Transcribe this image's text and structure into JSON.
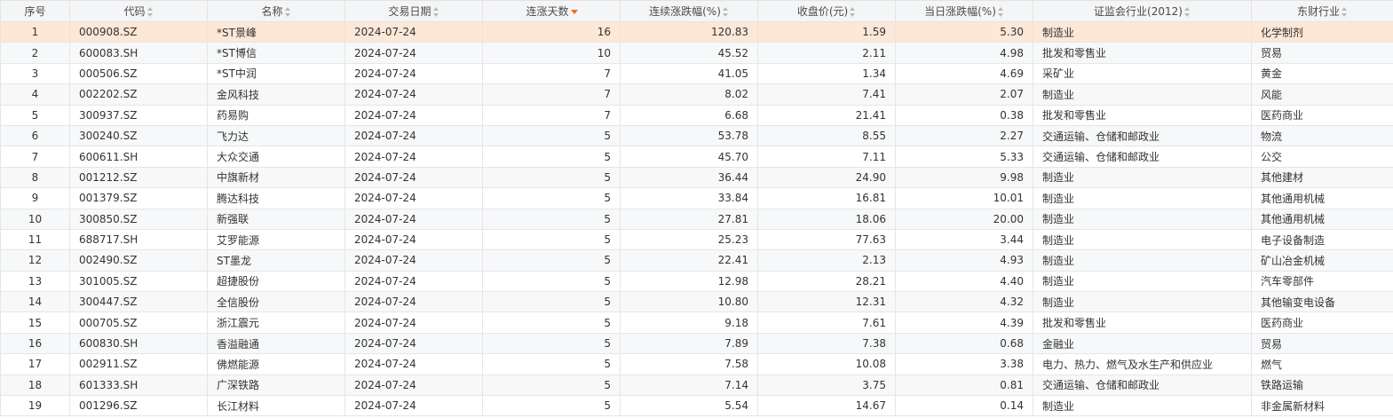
{
  "table": {
    "headers": [
      {
        "label": "序号",
        "sortable": false
      },
      {
        "label": "代码",
        "sortable": true
      },
      {
        "label": "名称",
        "sortable": true
      },
      {
        "label": "交易日期",
        "sortable": true
      },
      {
        "label": "连涨天数",
        "sortable": true,
        "active_sort": "desc"
      },
      {
        "label": "连续涨跌幅(%)",
        "sortable": true
      },
      {
        "label": "收盘价(元)",
        "sortable": true
      },
      {
        "label": "当日涨跌幅(%)",
        "sortable": true
      },
      {
        "label": "证监会行业(2012)",
        "sortable": true
      },
      {
        "label": "东财行业",
        "sortable": true
      }
    ],
    "highlight_row": 0,
    "highlight_color": "#fde7d7",
    "active_sort_color": "#f26b1d",
    "rows": [
      [
        "1",
        "000908.SZ",
        "*ST景峰",
        "2024-07-24",
        "16",
        "120.83",
        "1.59",
        "5.30",
        "制造业",
        "化学制剂"
      ],
      [
        "2",
        "600083.SH",
        "*ST博信",
        "2024-07-24",
        "10",
        "45.52",
        "2.11",
        "4.98",
        "批发和零售业",
        "贸易"
      ],
      [
        "3",
        "000506.SZ",
        "*ST中润",
        "2024-07-24",
        "7",
        "41.05",
        "1.34",
        "4.69",
        "采矿业",
        "黄金"
      ],
      [
        "4",
        "002202.SZ",
        "金风科技",
        "2024-07-24",
        "7",
        "8.02",
        "7.41",
        "2.07",
        "制造业",
        "风能"
      ],
      [
        "5",
        "300937.SZ",
        "药易购",
        "2024-07-24",
        "7",
        "6.68",
        "21.41",
        "0.38",
        "批发和零售业",
        "医药商业"
      ],
      [
        "6",
        "300240.SZ",
        "飞力达",
        "2024-07-24",
        "5",
        "53.78",
        "8.55",
        "2.27",
        "交通运输、仓储和邮政业",
        "物流"
      ],
      [
        "7",
        "600611.SH",
        "大众交通",
        "2024-07-24",
        "5",
        "45.70",
        "7.11",
        "5.33",
        "交通运输、仓储和邮政业",
        "公交"
      ],
      [
        "8",
        "001212.SZ",
        "中旗新材",
        "2024-07-24",
        "5",
        "36.44",
        "24.90",
        "9.98",
        "制造业",
        "其他建材"
      ],
      [
        "9",
        "001379.SZ",
        "腾达科技",
        "2024-07-24",
        "5",
        "33.84",
        "16.81",
        "10.01",
        "制造业",
        "其他通用机械"
      ],
      [
        "10",
        "300850.SZ",
        "新强联",
        "2024-07-24",
        "5",
        "27.81",
        "18.06",
        "20.00",
        "制造业",
        "其他通用机械"
      ],
      [
        "11",
        "688717.SH",
        "艾罗能源",
        "2024-07-24",
        "5",
        "25.23",
        "77.63",
        "3.44",
        "制造业",
        "电子设备制造"
      ],
      [
        "12",
        "002490.SZ",
        "ST墨龙",
        "2024-07-24",
        "5",
        "22.41",
        "2.13",
        "4.93",
        "制造业",
        "矿山冶金机械"
      ],
      [
        "13",
        "301005.SZ",
        "超捷股份",
        "2024-07-24",
        "5",
        "12.98",
        "28.21",
        "4.40",
        "制造业",
        "汽车零部件"
      ],
      [
        "14",
        "300447.SZ",
        "全信股份",
        "2024-07-24",
        "5",
        "10.80",
        "12.31",
        "4.32",
        "制造业",
        "其他输变电设备"
      ],
      [
        "15",
        "000705.SZ",
        "浙江震元",
        "2024-07-24",
        "5",
        "9.18",
        "7.61",
        "4.39",
        "批发和零售业",
        "医药商业"
      ],
      [
        "16",
        "600830.SH",
        "香溢融通",
        "2024-07-24",
        "5",
        "7.89",
        "7.38",
        "0.68",
        "金融业",
        "贸易"
      ],
      [
        "17",
        "002911.SZ",
        "佛燃能源",
        "2024-07-24",
        "5",
        "7.58",
        "10.08",
        "3.38",
        "电力、热力、燃气及水生产和供应业",
        "燃气"
      ],
      [
        "18",
        "601333.SH",
        "广深铁路",
        "2024-07-24",
        "5",
        "7.14",
        "3.75",
        "0.81",
        "交通运输、仓储和邮政业",
        "铁路运输"
      ],
      [
        "19",
        "001296.SZ",
        "长江材料",
        "2024-07-24",
        "5",
        "5.54",
        "14.67",
        "0.14",
        "制造业",
        "非金属新材料"
      ]
    ]
  }
}
